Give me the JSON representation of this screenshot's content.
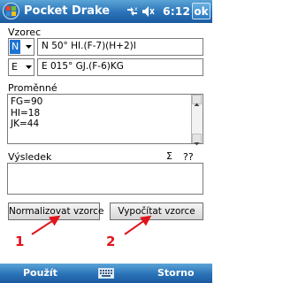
{
  "titlebar": {
    "app_title": "Pocket Drake",
    "time": "6:12",
    "ok_label": "ok"
  },
  "form": {
    "vzorec_label": "Vzorec",
    "row1": {
      "combo": "N",
      "formula": "N 50° HI.(F-7)(H+2)I"
    },
    "row2": {
      "combo": "E",
      "formula": "E 015° GJ.(F-6)KG"
    },
    "promenne_label": "Proměnné",
    "variables": "FG=90\nHI=18\nJK=44",
    "vysledek_label": "Výsledek",
    "sigma_label": "Σ",
    "qq_label": "??",
    "result_value": ""
  },
  "buttons": {
    "normalize": "Normalizovat vzorce",
    "compute": "Vypočítat vzorce"
  },
  "annotations": {
    "marker1": "1",
    "marker2": "2",
    "color": "#e0141a"
  },
  "bottombar": {
    "left": "Použít",
    "right": "Storno"
  },
  "colors": {
    "titlebar": "#2a72b8",
    "selection": "#1c74d3"
  }
}
